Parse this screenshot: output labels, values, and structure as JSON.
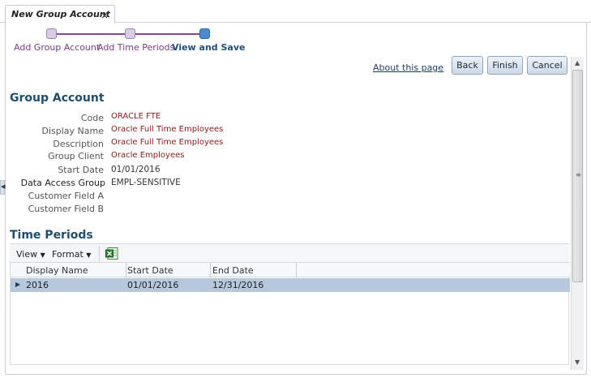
{
  "tab": {
    "title": "New Group Account",
    "close_glyph": "×"
  },
  "train": {
    "steps": [
      {
        "label": "Add Group Account",
        "state": "visited"
      },
      {
        "label": "Add Time Periods",
        "state": "visited"
      },
      {
        "label": "View and Save",
        "state": "current"
      }
    ]
  },
  "actions": {
    "about_link": "About this page",
    "back": "Back",
    "finish": "Finish",
    "cancel": "Cancel"
  },
  "group_account": {
    "title": "Group Account",
    "fields": [
      {
        "label": "Code",
        "value": "ORACLE FTE"
      },
      {
        "label": "Display Name",
        "value": "Oracle Full Time Employees"
      },
      {
        "label": "Description",
        "value": "Oracle Full Time Employees"
      },
      {
        "label": "Group Client",
        "value": "Oracle Employees"
      },
      {
        "label": "Start Date",
        "value": "01/01/2016"
      },
      {
        "label": "Data Access Group",
        "value": "EMPL-SENSITIVE"
      },
      {
        "label": "Customer Field A",
        "value": ""
      },
      {
        "label": "Customer Field B",
        "value": ""
      }
    ]
  },
  "time_periods": {
    "title": "Time Periods",
    "toolbar": {
      "view": "View",
      "format": "Format"
    },
    "columns": [
      "Display Name",
      "Start Date",
      "End Date"
    ],
    "rows": [
      {
        "display_name": "2016",
        "start_date": "01/01/2016",
        "end_date": "12/31/2016"
      }
    ]
  },
  "colors": {
    "accent": "#1f4f6b",
    "train_line": "#7a4b94",
    "selected_row": "#b6c9dc",
    "value_text": "#8a1a1a"
  }
}
